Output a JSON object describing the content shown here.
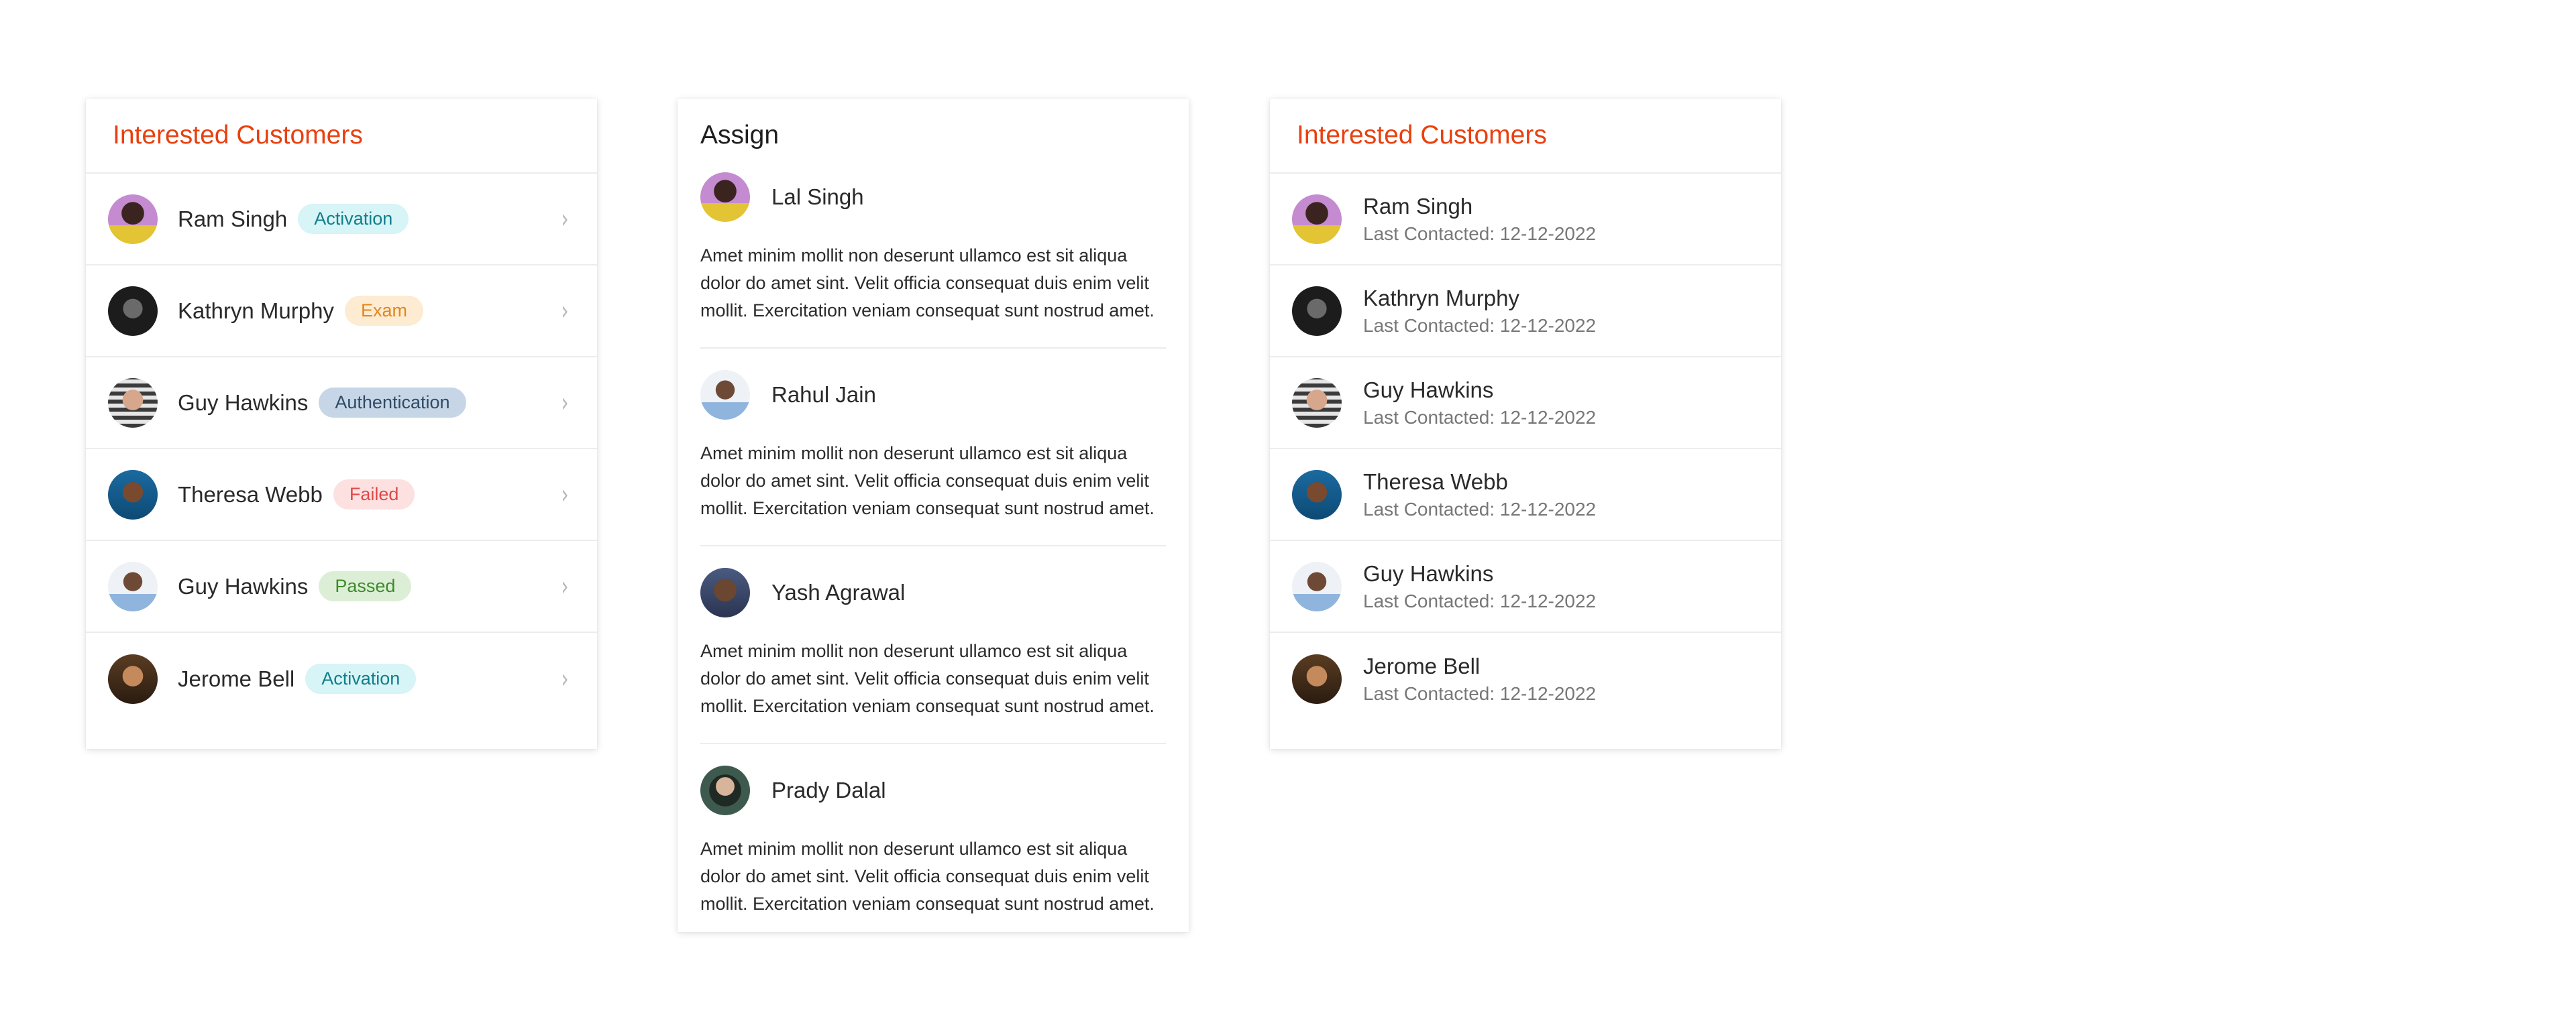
{
  "card1": {
    "title": "Interested Customers",
    "rows": [
      {
        "name": "Ram Singh",
        "badge": "Activation",
        "avatar": "avatar-ram-singh"
      },
      {
        "name": "Kathryn Murphy",
        "badge": "Exam",
        "avatar": "avatar-kathryn-murphy"
      },
      {
        "name": "Guy Hawkins",
        "badge": "Authentication",
        "avatar": "avatar-guy-hawkins"
      },
      {
        "name": "Theresa Webb",
        "badge": "Failed",
        "avatar": "avatar-theresa-webb"
      },
      {
        "name": "Guy Hawkins",
        "badge": "Passed",
        "avatar": "avatar-guy-hawkins"
      },
      {
        "name": "Jerome Bell",
        "badge": "Activation",
        "avatar": "avatar-jerome-bell"
      }
    ],
    "chevron_icon": "chevron-right-icon",
    "badge_colors": {
      "Activation": "#d7f4f7",
      "Exam": "#fdebd2",
      "Authentication": "#c7d6e6",
      "Failed": "#fde0e0",
      "Passed": "#dcefd6"
    }
  },
  "card2": {
    "title": "Assign",
    "items": [
      {
        "name": "Lal Singh",
        "text": "Amet minim mollit non deserunt ullamco est sit aliqua dolor do amet sint. Velit officia consequat duis enim velit mollit. Exercitation veniam consequat sunt nostrud amet."
      },
      {
        "name": "Rahul Jain",
        "text": "Amet minim mollit non deserunt ullamco est sit aliqua dolor do amet sint. Velit officia consequat duis enim velit mollit. Exercitation veniam consequat sunt nostrud amet."
      },
      {
        "name": "Yash Agrawal",
        "text": "Amet minim mollit non deserunt ullamco est sit aliqua dolor do amet sint. Velit officia consequat duis enim velit mollit. Exercitation veniam consequat sunt nostrud amet."
      },
      {
        "name": "Prady Dalal",
        "text": "Amet minim mollit non deserunt ullamco est sit aliqua dolor do amet sint. Velit officia consequat duis enim velit mollit. Exercitation veniam consequat sunt nostrud amet."
      }
    ]
  },
  "card3": {
    "title": "Interested Customers",
    "rows": [
      {
        "name": "Ram Singh",
        "sub": "Last Contacted: 12-12-2022"
      },
      {
        "name": "Kathryn Murphy",
        "sub": "Last Contacted: 12-12-2022"
      },
      {
        "name": "Guy Hawkins",
        "sub": "Last Contacted: 12-12-2022"
      },
      {
        "name": "Theresa Webb",
        "sub": "Last Contacted: 12-12-2022"
      },
      {
        "name": "Guy Hawkins",
        "sub": "Last Contacted: 12-12-2022"
      },
      {
        "name": "Jerome Bell",
        "sub": "Last Contacted: 12-12-2022"
      }
    ]
  },
  "colors": {
    "accent": "#e8400f",
    "divider": "#ececec"
  }
}
